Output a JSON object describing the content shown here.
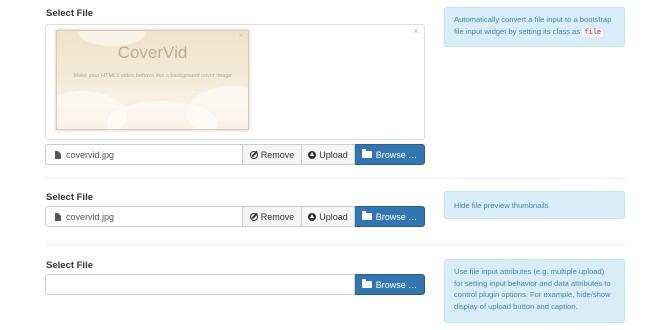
{
  "sections": [
    {
      "label": "Select File",
      "preview": {
        "title": "CoverVid",
        "subtitle": "Make your HTML5 video behave like a background cover image",
        "close_glyph": "×"
      },
      "caption": "covervid.jpg",
      "remove_label": "Remove",
      "upload_label": "Upload",
      "browse_label": "Browse …",
      "info_text": "Automatically convert a file input to a bootstrap file input widget by setting its class as",
      "info_code": "file"
    },
    {
      "label": "Select File",
      "caption": "covervid.jpg",
      "remove_label": "Remove",
      "upload_label": "Upload",
      "browse_label": "Browse …",
      "info_text": "Hide file preview thumbnails"
    },
    {
      "label": "Select File",
      "caption": "",
      "browse_label": "Browse …",
      "info_text": "Use file input attributes (e.g. multiple upload) for setting input behavior and data attributes to control plugin options. For example, hide/show display of upload button and caption."
    }
  ],
  "icons": {
    "file": "file-icon",
    "remove": "ban-icon",
    "upload": "upload-icon",
    "browse": "folder-open-icon",
    "close": "close-icon"
  },
  "colors": {
    "primary": "#3276b1",
    "info_bg": "#d9edf7",
    "info_text": "#3a87ad",
    "code_text": "#c7254e"
  }
}
